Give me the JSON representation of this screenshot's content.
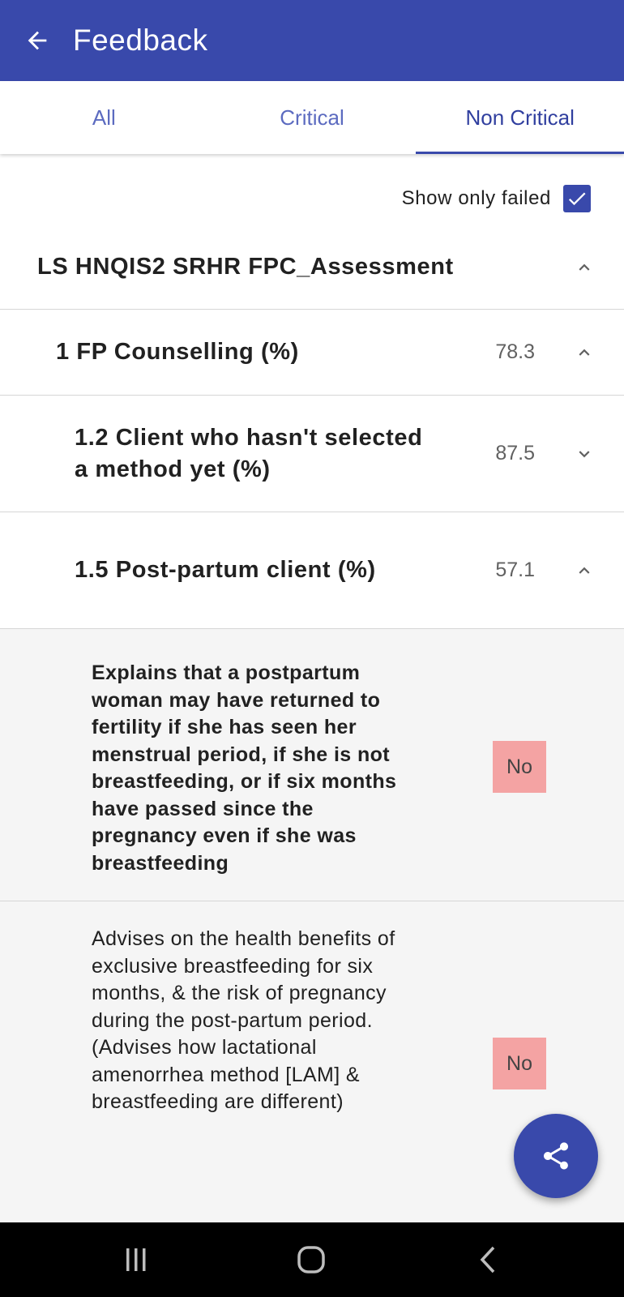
{
  "appbar": {
    "title": "Feedback",
    "back_icon": "arrow-left-icon"
  },
  "tabs": [
    {
      "label": "All",
      "active": false
    },
    {
      "label": "Critical",
      "active": false
    },
    {
      "label": "Non Critical",
      "active": true
    }
  ],
  "filter": {
    "label": "Show only failed",
    "checked": true
  },
  "program": {
    "title": "LS HNQIS2 SRHR FPC_Assessment",
    "expanded": true
  },
  "section": {
    "title": "1 FP Counselling (%)",
    "score": "78.3",
    "expanded": true
  },
  "subsections": [
    {
      "title": "1.2 Client who hasn't selected a method yet (%)",
      "score": "87.5",
      "expanded": false
    },
    {
      "title": "1.5 Post-partum client (%)",
      "score": "57.1",
      "expanded": true
    }
  ],
  "questions": [
    {
      "text": "Explains that a postpartum woman may have returned to fertility if she has seen her menstrual period, if she is not breastfeeding, or if six months have passed since the pregnancy even if she was breastfeeding",
      "answer": "No",
      "critical": true
    },
    {
      "text": "Advises on the health benefits of exclusive breastfeeding for six months, & the risk of pregnancy during the post-partum period. (Advises how lactational amenorrhea method [LAM] & breastfeeding are different)",
      "answer": "No",
      "critical": false
    }
  ],
  "fab": {
    "icon": "share-icon"
  },
  "colors": {
    "primary": "#3949ab",
    "fail_badge": "#f4a3a3"
  }
}
